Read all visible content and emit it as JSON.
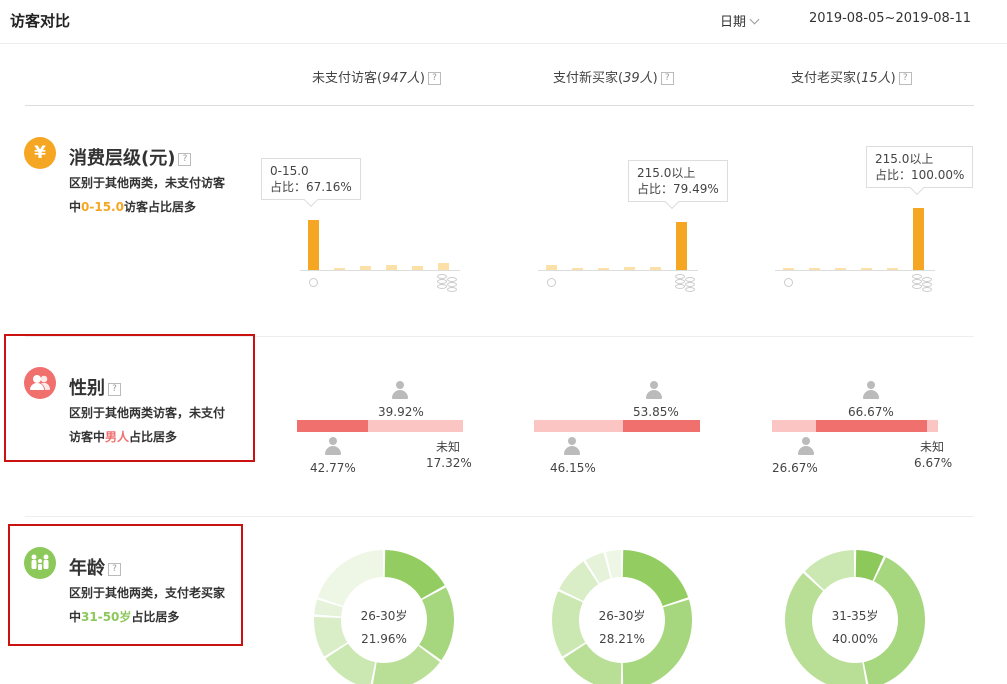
{
  "header": {
    "title": "访客对比",
    "date_label": "日期",
    "date_range": "2019-08-05~2019-08-11"
  },
  "columns": [
    {
      "label": "未支付访客",
      "count": "947人"
    },
    {
      "label": "支付新买家",
      "count": "39人"
    },
    {
      "label": "支付老买家",
      "count": "15人"
    }
  ],
  "help_glyph": "?",
  "sections": {
    "spend": {
      "icon": "yen-icon",
      "icon_glyph": "¥",
      "icon_color": "#f5a623",
      "title": "消费层级(元)",
      "desc_pre": "区别于其他两类，未支付访客中",
      "desc_hl": "0-15.0",
      "desc_post": "访客占比居多",
      "charts": [
        {
          "tip_range": "0-15.0",
          "tip_ratio": "占比：67.16%",
          "bars": [
            67.16,
            3,
            6,
            7,
            6,
            11.5
          ],
          "main": 0
        },
        {
          "tip_range": "215.0以上",
          "tip_ratio": "占比：79.49%",
          "bars": [
            7.5,
            2.5,
            2.5,
            5,
            5,
            79.49
          ],
          "main": 5
        },
        {
          "tip_range": "215.0以上",
          "tip_ratio": "占比：100.00%",
          "bars": [
            1.5,
            1.5,
            1.5,
            1.5,
            1.5,
            100
          ],
          "main": 5
        }
      ]
    },
    "gender": {
      "icon": "users-icon",
      "icon_color": "#f0706e",
      "title": "性别",
      "desc_pre": "区别于其他两类访客，未支付访客中",
      "desc_hl": "男人",
      "desc_post": "占比居多",
      "charts": [
        {
          "female": "39.92%",
          "male": "42.77%",
          "unknown_label": "未知",
          "unknown": "17.32%",
          "female_pct": 39.92,
          "male_pct": 42.77,
          "unknown_pct": 17.32
        },
        {
          "female": "53.85%",
          "male": "46.15%",
          "female_pct": 53.85,
          "male_pct": 46.15
        },
        {
          "female": "66.67%",
          "male": "26.67%",
          "unknown_label": "未知",
          "unknown": "6.67%",
          "female_pct": 66.67,
          "male_pct": 26.67,
          "unknown_pct": 6.67
        }
      ]
    },
    "age": {
      "icon": "family-icon",
      "icon_color": "#8cc85a",
      "title": "年龄",
      "desc_pre": "区别于其他两类，支付老买家中",
      "desc_hl": "31-50岁",
      "desc_post": "占比居多",
      "charts": [
        {
          "center_label": "26-30岁",
          "center_value": "21.96%",
          "slices": [
            17,
            18,
            18,
            13,
            10,
            4,
            20
          ]
        },
        {
          "center_label": "26-30岁",
          "center_value": "28.21%",
          "slices": [
            20,
            30,
            16,
            16,
            9,
            5,
            4
          ]
        },
        {
          "center_label": "31-35岁",
          "center_value": "40.00%",
          "slices": [
            7,
            40,
            40,
            13
          ]
        }
      ]
    }
  }
}
